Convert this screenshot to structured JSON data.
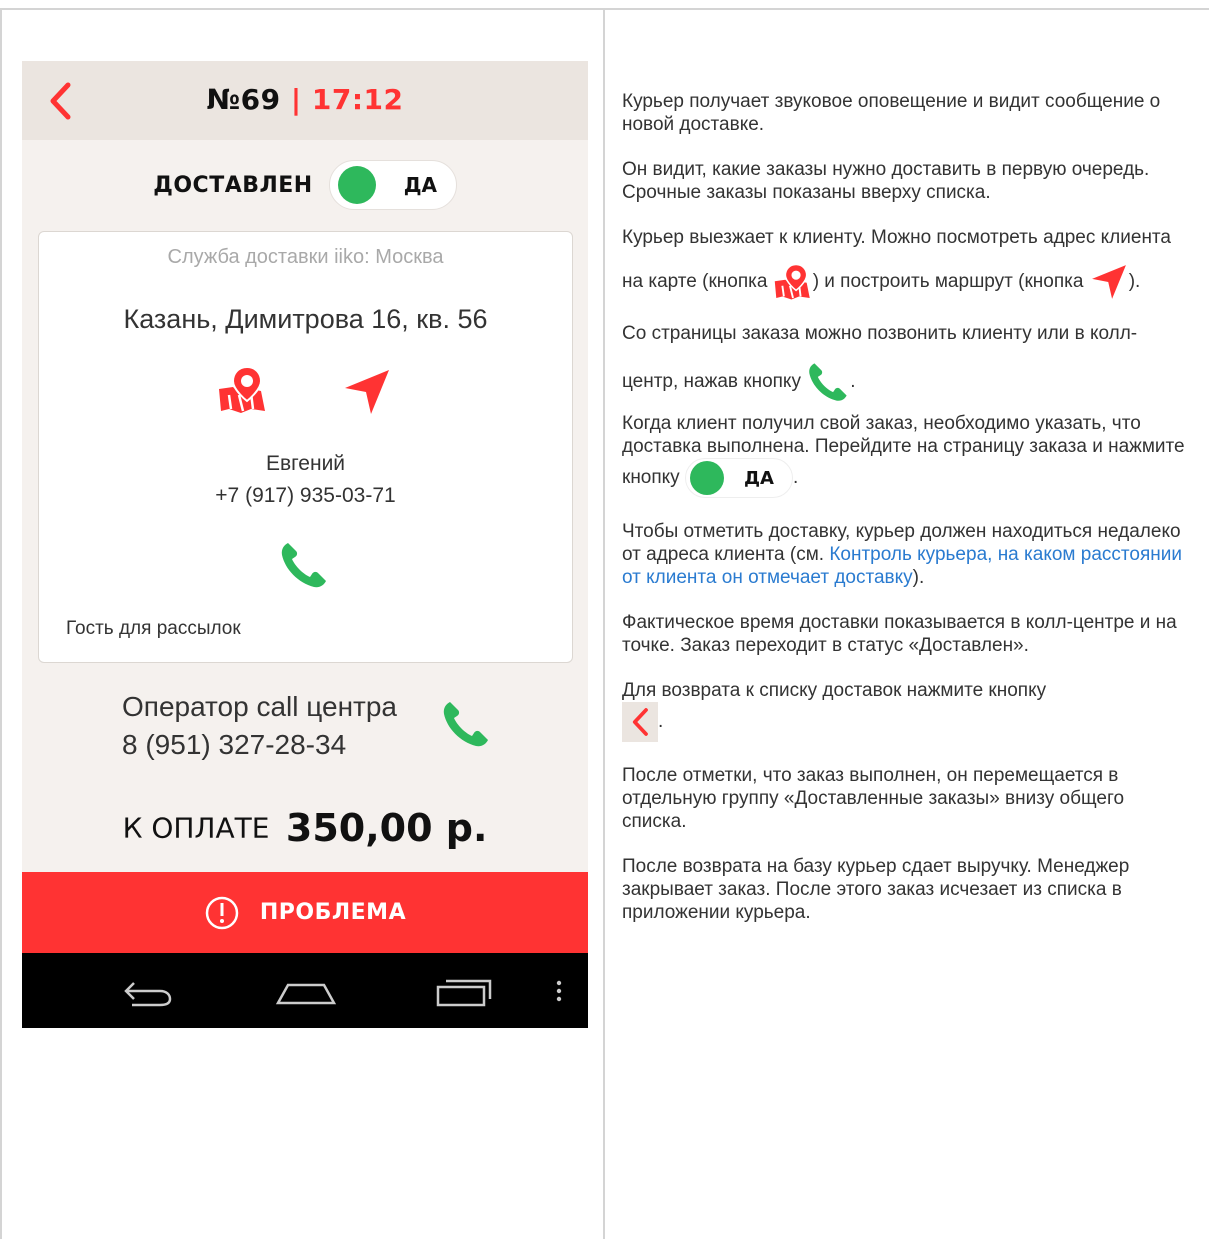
{
  "phone": {
    "order_number": "№69",
    "separator": "|",
    "time": "17:12",
    "delivered_label": "ДОСТАВЛЕН",
    "toggle_yes": "ДА",
    "service": "Служба доставки iiko: Москва",
    "address": "Казань, Димитрова 16, кв. 56",
    "client_name": "Евгений",
    "client_phone": "+7 (917) 935-03-71",
    "guest_label": "Гость для рассылок",
    "operator_label": "Оператор call центра",
    "operator_phone": "8 (951) 327-28-34",
    "pay_label": "К ОПЛАТЕ",
    "pay_amount": "350,00 р.",
    "problem_label": "ПРОБЛЕМА"
  },
  "colors": {
    "accent_red": "#ff3333",
    "green": "#2eb85c",
    "link": "#2a7bd0"
  },
  "icons": [
    "chevron-left-icon",
    "map-pin-icon",
    "navigation-arrow-icon",
    "phone-icon",
    "exclamation-icon",
    "android-back-icon",
    "android-home-icon",
    "android-recents-icon",
    "android-menu-icon"
  ],
  "desc": {
    "p1": "Курьер получает звуковое оповещение и видит сообщение о новой доставке.",
    "p2": "Он видит, какие заказы нужно доставить в первую очередь. Срочные заказы показаны вверху списка.",
    "p3a": "Курьер выезжает к клиенту. Можно посмотреть адрес клиента на карте (кнопка",
    "p3b": ") и построить маршрут (кнопка",
    "p3c": ").",
    "p4a": "Со страницы заказа можно позвонить клиенту или в колл-центр, нажав кнопку",
    "p4b": ".",
    "p5a": "Когда клиент получил свой заказ, необходимо указать, что доставка выполнена. Перейдите на страницу заказа и нажмите кнопку",
    "p5b": ".",
    "p6a": "Чтобы отметить доставку, курьер должен находиться недалеко от адреса клиента (см.",
    "p6_link": "Контроль курьера, на каком расстоянии от клиента он отмечает доставку",
    "p6b": ").",
    "p7": "Фактическое время доставки показывается в колл-центре и на точке. Заказ переходит в статус «Доставлен».",
    "p8a": "Для возврата к списку доставок нажмите кнопку",
    "p8b": ".",
    "p9": "После отметки, что заказ выполнен, он перемещается в отдельную группу «Доставленные заказы» внизу общего списка.",
    "p10": "После возврата на базу курьер сдает выручку. Менеджер закрывает заказ. После этого заказ исчезает из списка в приложении курьера."
  }
}
